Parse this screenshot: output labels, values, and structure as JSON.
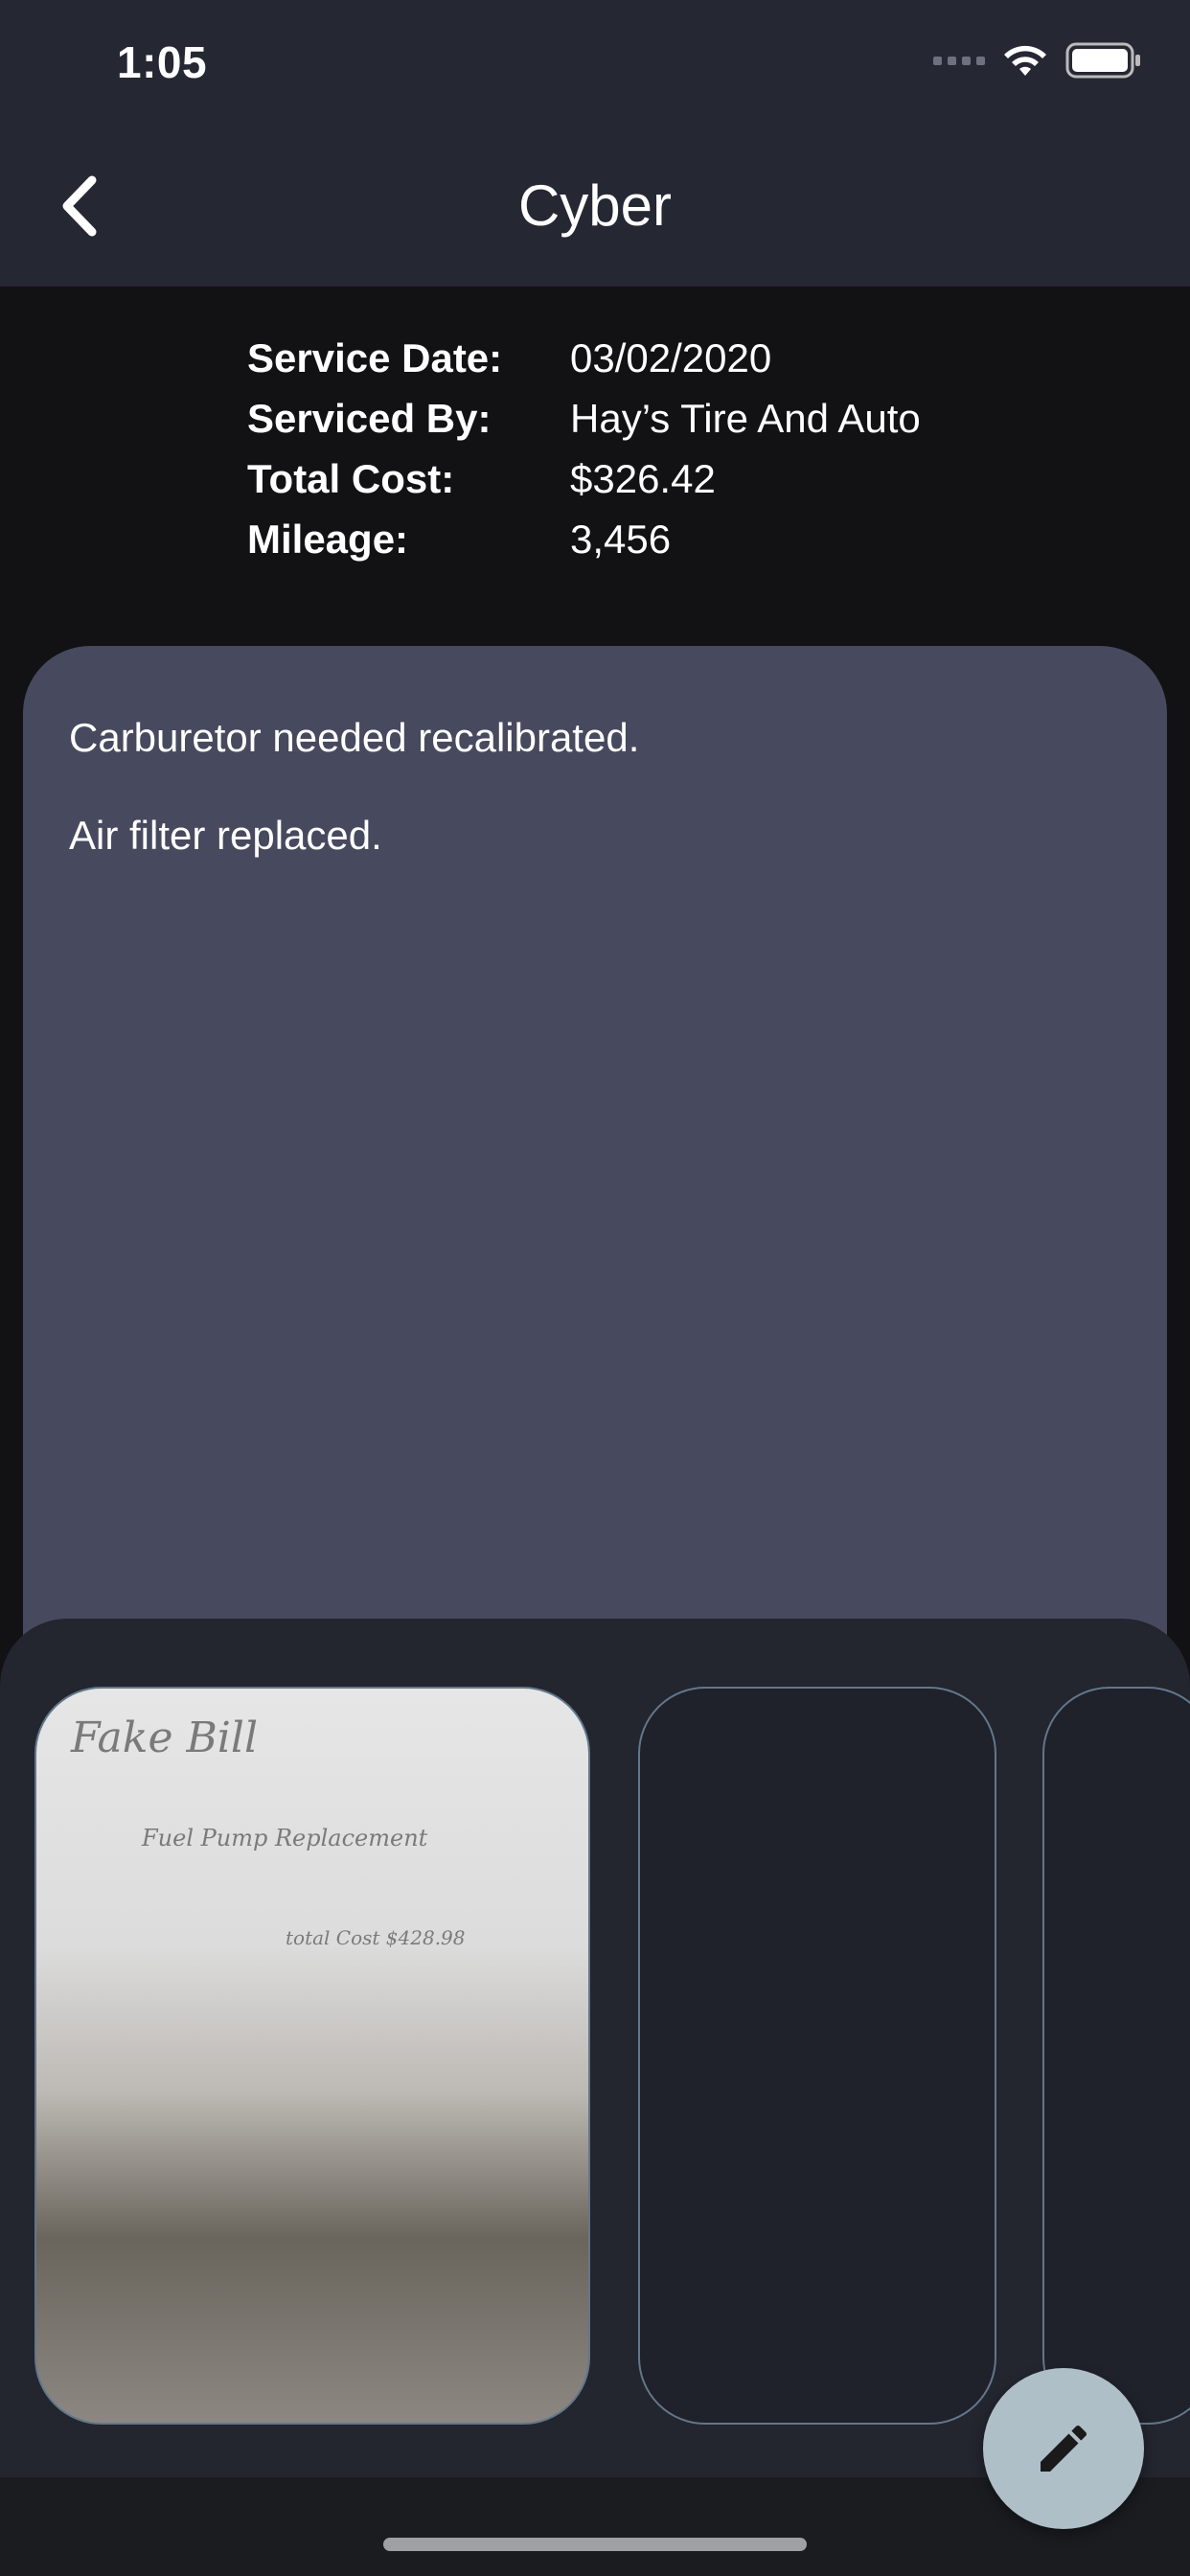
{
  "status": {
    "time": "1:05"
  },
  "header": {
    "title": "Cyber"
  },
  "service": {
    "rows": [
      {
        "label": "Service Date:",
        "value": "03/02/2020"
      },
      {
        "label": "Serviced By:",
        "value": "Hay’s Tire And Auto"
      },
      {
        "label": "Total Cost:",
        "value": "$326.42"
      },
      {
        "label": "Mileage:",
        "value": "3,456"
      }
    ]
  },
  "notes": {
    "line1": "Carburetor needed recalibrated.",
    "line2": "Air filter replaced."
  },
  "photos": {
    "receipt": {
      "title": "Fake Bill",
      "item": "Fuel Pump Replacement",
      "total": "total Cost $428.98"
    }
  },
  "icons": {
    "back": "chevron-left-icon",
    "fab": "pencil-icon",
    "wifi": "wifi-icon",
    "battery": "battery-icon"
  },
  "colors": {
    "topbar": "#252733",
    "background": "#121214",
    "notes_panel": "#474a5e",
    "photo_sheet": "#23252f",
    "fab": "#aebfc8",
    "card_border": "#62778a"
  }
}
